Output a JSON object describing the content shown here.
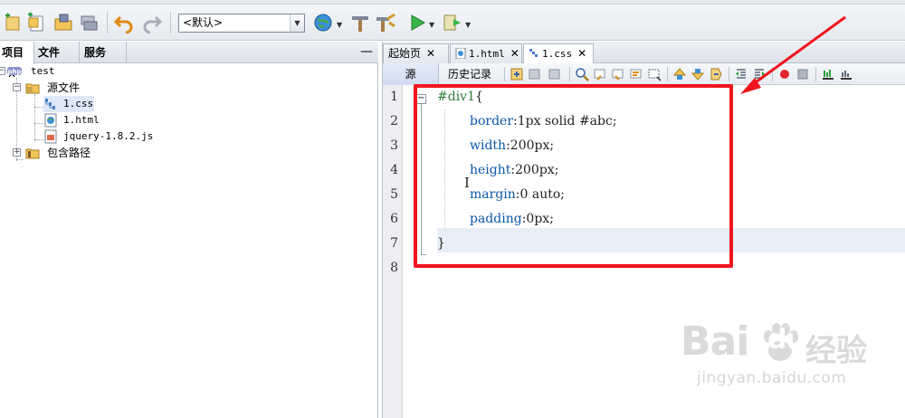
{
  "toolbar": {
    "config_value": "<默认>",
    "icons": [
      "new-project-icon",
      "new-file-icon",
      "open-project-icon",
      "close-project-icon",
      "undo-icon",
      "redo-icon",
      "browser-icon",
      "build-icon",
      "clean-build-icon",
      "run-icon",
      "debug-icon"
    ]
  },
  "left_panel": {
    "tabs": [
      {
        "label": "项目",
        "close": "✕"
      },
      {
        "label": "文件"
      },
      {
        "label": "服务"
      }
    ],
    "minimize": "—",
    "tree": {
      "project": "test",
      "project_badge": "php",
      "source_folder": "源文件",
      "files": [
        "1.css",
        "1.html",
        "jquery-1.8.2.js"
      ],
      "include_path": "包含路径"
    }
  },
  "editor": {
    "tabs": [
      {
        "label": "起始页",
        "close": "✕"
      },
      {
        "label": "1.html",
        "close": "✕"
      },
      {
        "label": "1.css",
        "close": "✕"
      }
    ],
    "source_label": "源",
    "history_label": "历史记录",
    "line_numbers": [
      "1",
      "2",
      "3",
      "4",
      "5",
      "6",
      "7",
      "8"
    ],
    "code": {
      "l1_selector": "#div1",
      "l1_brace": "{",
      "l2_prop": "border",
      "l2_val": "1px solid #abc",
      "l3_prop": "width",
      "l3_val": "200px",
      "l4_prop": "height",
      "l4_val": "200px",
      "l5_prop": "margin",
      "l5_val": "0 auto",
      "l6_prop": "padding",
      "l6_val": "0px",
      "l7_brace": "}",
      "colon": ":",
      "semi": ";"
    },
    "cursor_glyph": "I",
    "fold_open": "−"
  },
  "watermark": {
    "brand_left": "Bai",
    "brand_right": "du",
    "brand_cn": "经验",
    "url": "jingyan.baidu.com"
  },
  "colors": {
    "annotation": "#f0141e",
    "selector": "#2f7d3a",
    "property": "#0b57a8"
  }
}
